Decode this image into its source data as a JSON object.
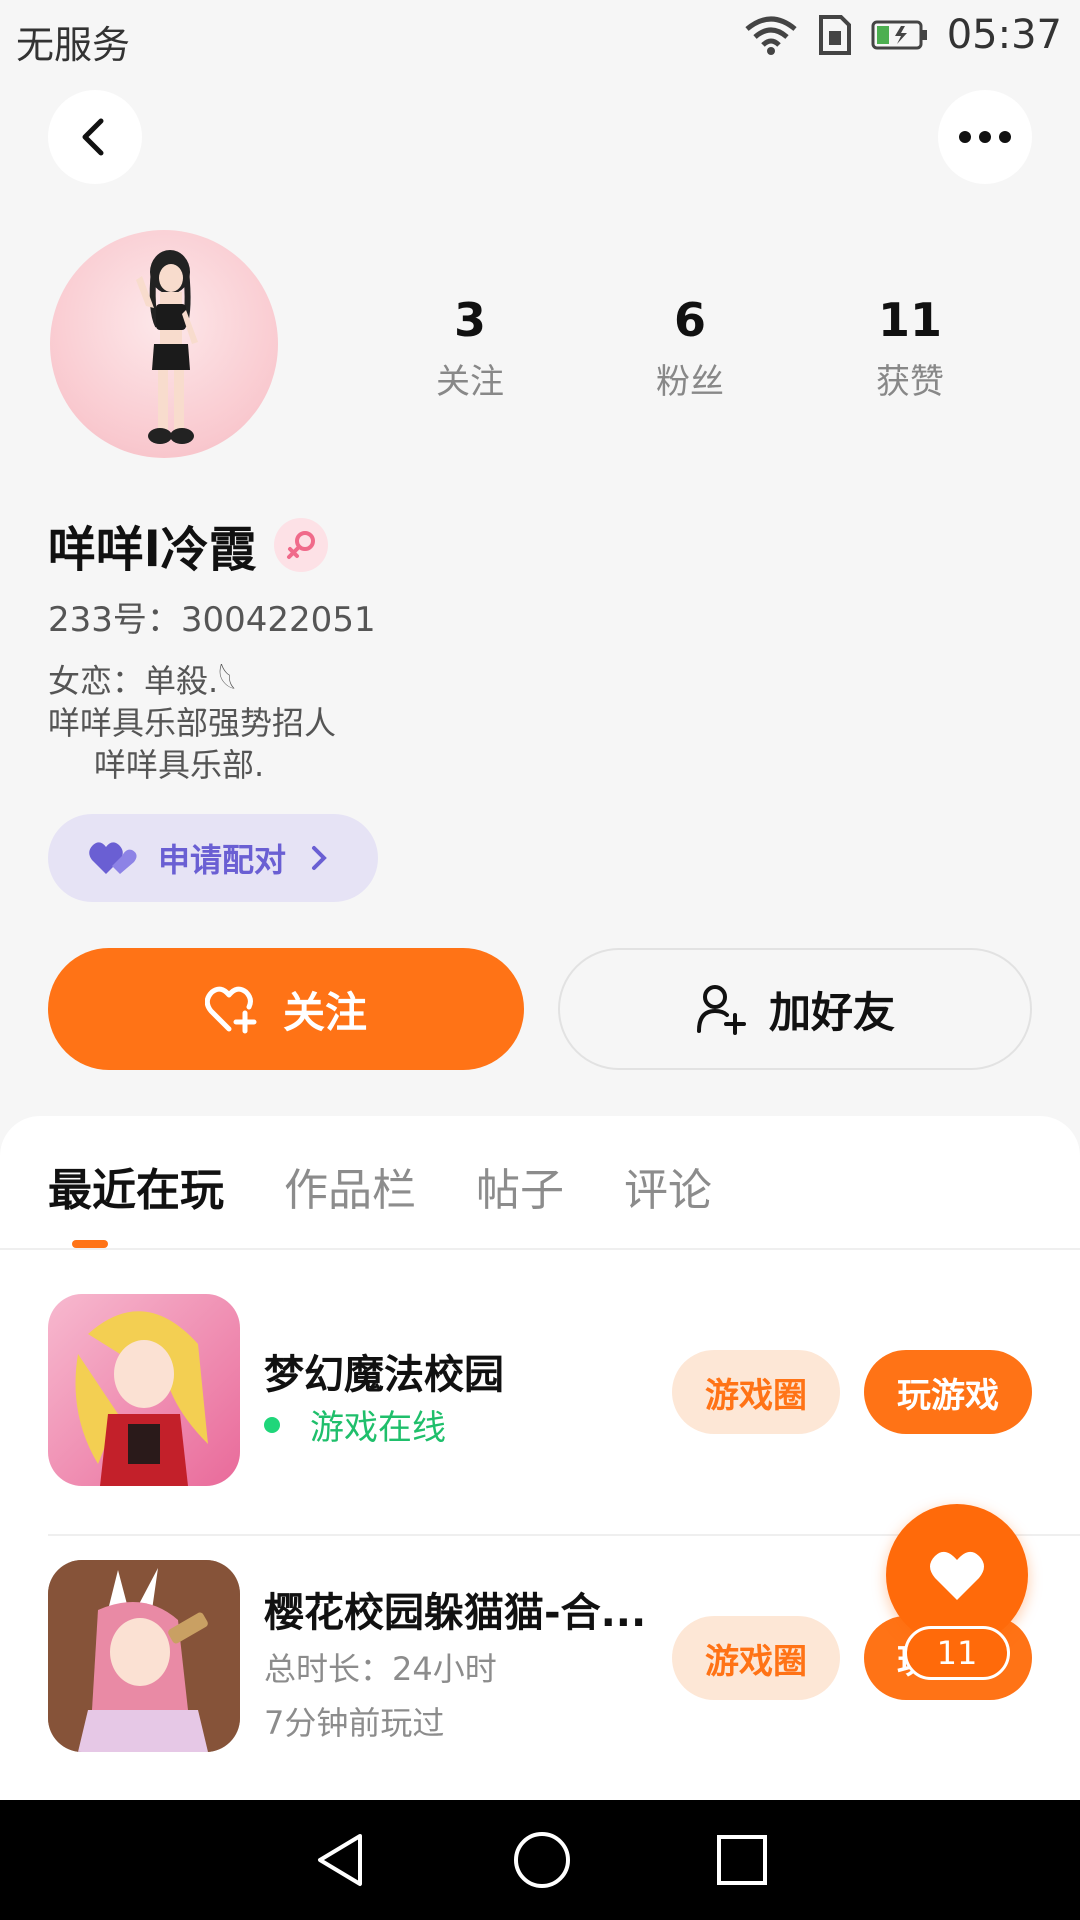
{
  "status_bar": {
    "carrier": "无服务",
    "time": "05:37"
  },
  "profile": {
    "stats": [
      {
        "value": "3",
        "label": "关注"
      },
      {
        "value": "6",
        "label": "粉丝"
      },
      {
        "value": "11",
        "label": "获赞"
      }
    ],
    "username": "咩咩l冷霞",
    "user_id": "233号：300422051",
    "bio": [
      "女恋：单殺.𓆩",
      "咩咩具乐部强势招人",
      "咩咩具乐部."
    ],
    "pair_label": "申请配对",
    "follow_label": "关注",
    "add_friend_label": "加好友"
  },
  "tabs": [
    "最近在玩",
    "作品栏",
    "帖子",
    "评论"
  ],
  "games": [
    {
      "title": "梦幻魔法校园",
      "status": "游戏在线",
      "circle_label": "游戏圈",
      "play_label": "玩游戏"
    },
    {
      "title": "樱花校园躲猫猫-合...",
      "duration": "总时长：24小时",
      "last_played": "7分钟前玩过",
      "circle_label": "游戏圈",
      "play_label": "玩游戏"
    }
  ],
  "float_like": {
    "count": "11"
  },
  "colors": {
    "accent": "#ff7316",
    "pair_bg": "#e6e3f5",
    "pair_text": "#6a5fd3",
    "online": "#1fbf6b"
  }
}
